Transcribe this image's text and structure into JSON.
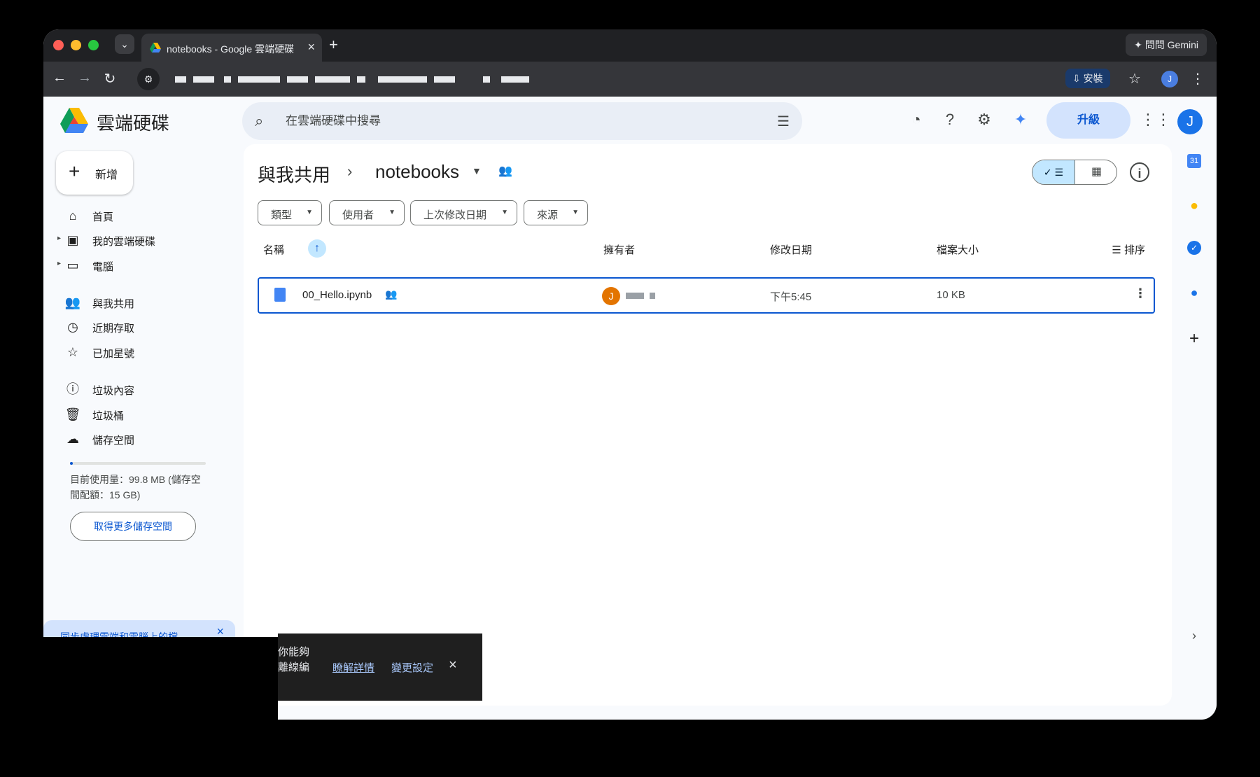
{
  "browser": {
    "tab_title": "notebooks - Google 雲端硬碟",
    "new_tab": "+",
    "gemini_label": "✦ 問問 Gemini",
    "install_label": "安裝",
    "profile_initial": "J"
  },
  "app": {
    "name": "雲端硬碟",
    "search_placeholder": "在雲端硬碟中搜尋",
    "upgrade_label": "升級",
    "avatar_initial": "J"
  },
  "sidebar": {
    "new_label": "新增",
    "items": [
      {
        "label": "首頁",
        "icon": "home-icon"
      },
      {
        "label": "我的雲端硬碟",
        "icon": "my-drive-icon"
      },
      {
        "label": "電腦",
        "icon": "computers-icon"
      },
      {
        "label": "與我共用",
        "icon": "shared-with-me-icon"
      },
      {
        "label": "近期存取",
        "icon": "recent-icon"
      },
      {
        "label": "已加星號",
        "icon": "star-icon"
      },
      {
        "label": "垃圾內容",
        "icon": "spam-icon"
      },
      {
        "label": "垃圾桶",
        "icon": "trash-icon"
      },
      {
        "label": "儲存空間",
        "icon": "cloud-icon"
      }
    ],
    "storage_text": "目前使用量：99.8 MB (儲存空間配額：15 GB)",
    "more_storage_label": "取得更多儲存空間",
    "sync_banner_text": "同步處理雲端和電腦上的檔",
    "storage_fraction": 0.0067
  },
  "main": {
    "breadcrumb_root": "與我共用",
    "breadcrumb_current": "notebooks",
    "filters": [
      "類型",
      "使用者",
      "上次修改日期",
      "來源"
    ],
    "columns": {
      "name": "名稱",
      "owner": "擁有者",
      "modified": "修改日期",
      "size": "檔案大小",
      "sort": "排序"
    },
    "files": [
      {
        "name": "00_Hello.ipynb",
        "owner_initial": "J",
        "modified": "下午5:45",
        "size": "10 KB"
      }
    ]
  },
  "rail": {
    "calendar_label": "31"
  },
  "toast": {
    "text_line1": "你能夠",
    "text_line2": "離線編",
    "learn_more": "瞭解詳情",
    "change_settings": "變更設定"
  },
  "colors": {
    "accent": "#0b57d0",
    "chip_selected": "#c2e7ff",
    "upgrade_bg": "#d3e3fd"
  }
}
